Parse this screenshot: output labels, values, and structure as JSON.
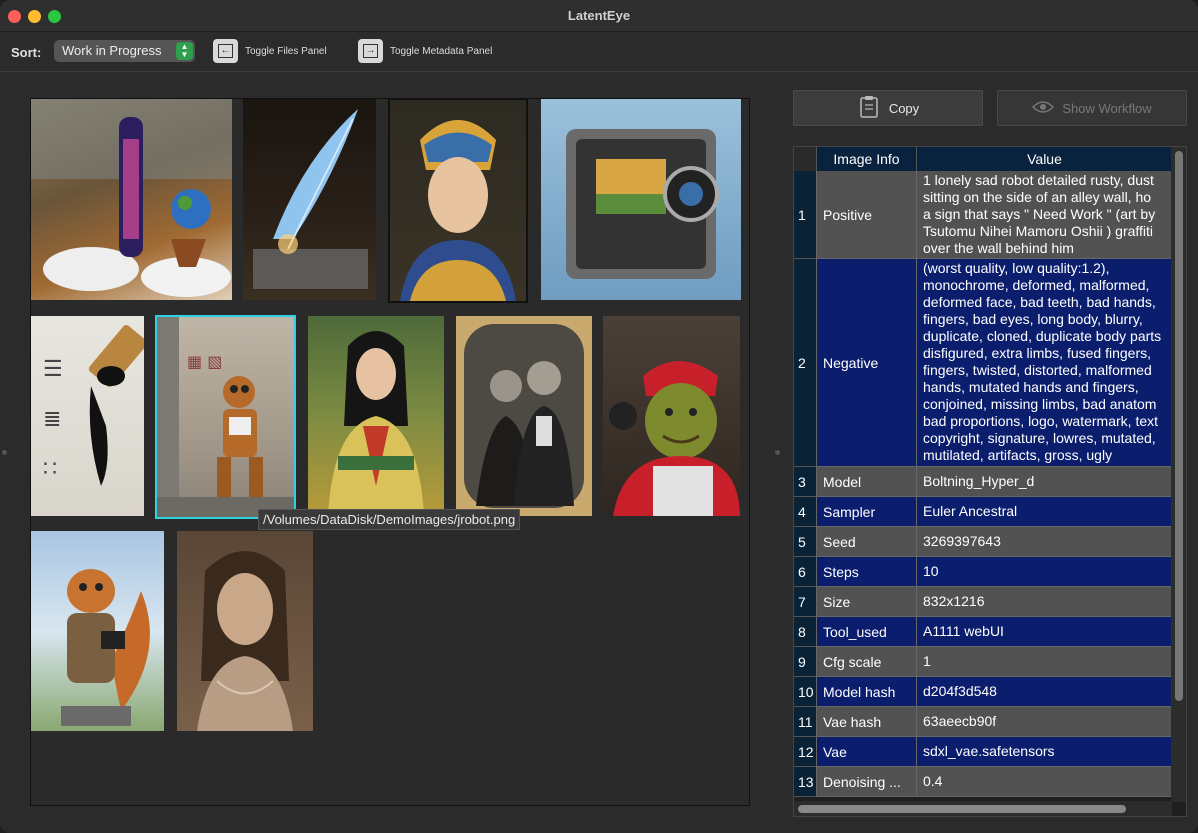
{
  "window": {
    "title": "LatentEye"
  },
  "toolbar": {
    "sort_label": "Sort:",
    "sort_value": "Work in Progress",
    "toggle_files": "Toggle Files Panel",
    "toggle_metadata": "Toggle Metadata Panel"
  },
  "grid": {
    "tooltip": "/Volumes/DataDisk/DemoImages/jrobot.png"
  },
  "actions": {
    "copy": "Copy",
    "show_workflow": "Show Workflow"
  },
  "table": {
    "headers": [
      "Image Info",
      "Value"
    ],
    "rows": [
      {
        "n": "1",
        "key": "Positive",
        "lines": [
          "1 lonely sad robot detailed  rusty, dust",
          "sitting on the side of an alley wall,  ho",
          "a sign that says \" Need Work \" (art by",
          "Tsutomu Nihei Mamoru Oshii ) graffiti",
          "over the wall behind him"
        ]
      },
      {
        "n": "2",
        "key": "Negative",
        "lines": [
          "(worst quality, low quality:1.2),",
          "monochrome, deformed, malformed,",
          "deformed face, bad teeth, bad hands,",
          "fingers, bad eyes, long body, blurry,",
          "duplicate, cloned, duplicate body parts",
          "disfigured, extra limbs, fused fingers,",
          "fingers, twisted, distorted, malformed",
          "hands, mutated hands and fingers,",
          "conjoined, missing limbs, bad anatom",
          "bad proportions, logo, watermark, text",
          "copyright, signature, lowres, mutated,",
          "mutilated, artifacts, gross, ugly"
        ]
      },
      {
        "n": "3",
        "key": "Model",
        "lines": [
          "Boltning_Hyper_d"
        ]
      },
      {
        "n": "4",
        "key": "Sampler",
        "lines": [
          "Euler Ancestral"
        ]
      },
      {
        "n": "5",
        "key": "Seed",
        "lines": [
          "3269397643"
        ]
      },
      {
        "n": "6",
        "key": "Steps",
        "lines": [
          "10"
        ]
      },
      {
        "n": "7",
        "key": "Size",
        "lines": [
          "832x1216"
        ]
      },
      {
        "n": "8",
        "key": "Tool_used",
        "lines": [
          "A1111 webUI"
        ]
      },
      {
        "n": "9",
        "key": "Cfg scale",
        "lines": [
          "1"
        ]
      },
      {
        "n": "10",
        "key": "Model hash",
        "lines": [
          "d204f3d548"
        ]
      },
      {
        "n": "11",
        "key": "Vae hash",
        "lines": [
          "63aeecb90f"
        ]
      },
      {
        "n": "12",
        "key": "Vae",
        "lines": [
          "sdxl_vae.safetensors"
        ]
      },
      {
        "n": "13",
        "key": "Denoising ...",
        "lines": [
          "0.4"
        ]
      }
    ]
  }
}
